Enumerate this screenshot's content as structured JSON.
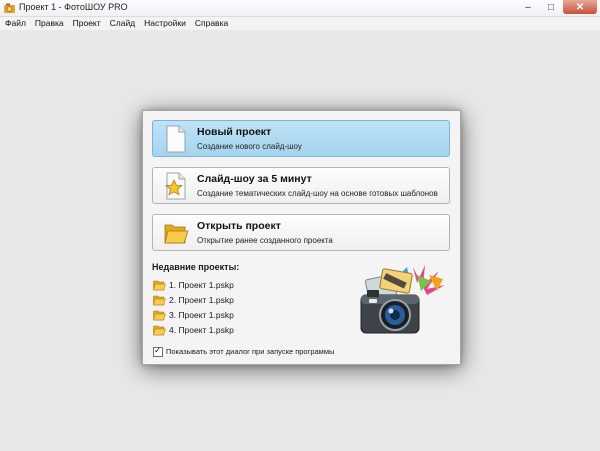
{
  "window": {
    "title": "Проект 1 - ФотоШОУ PRO",
    "buttons": {
      "minimize": "–",
      "maximize": "□",
      "close": "✕"
    }
  },
  "menu": [
    "Файл",
    "Правка",
    "Проект",
    "Слайд",
    "Настройки",
    "Справка"
  ],
  "dialog": {
    "cards": [
      {
        "title": "Новый проект",
        "desc": "Создание нового слайд-шоу",
        "icon": "blank-document-icon"
      },
      {
        "title": "Слайд-шоу за 5 минут",
        "desc": "Создание тематических слайд-шоу на основе готовых шаблонов",
        "icon": "star-document-icon"
      },
      {
        "title": "Открыть проект",
        "desc": "Открытие ранее созданного проекта",
        "icon": "open-folder-icon"
      }
    ],
    "recent_heading": "Недавние проекты:",
    "recent": [
      "1. Проект 1.pskp",
      "2. Проект 1.pskp",
      "3. Проект 1.pskp",
      "4. Проект 1.pskp"
    ],
    "show_on_startup_label": "Показывать этот диалог при запуске программы",
    "show_on_startup_checked": true,
    "check_mark": "✓"
  },
  "colors": {
    "active_card": "#a9d7f2",
    "folder": "#f4c33a"
  }
}
